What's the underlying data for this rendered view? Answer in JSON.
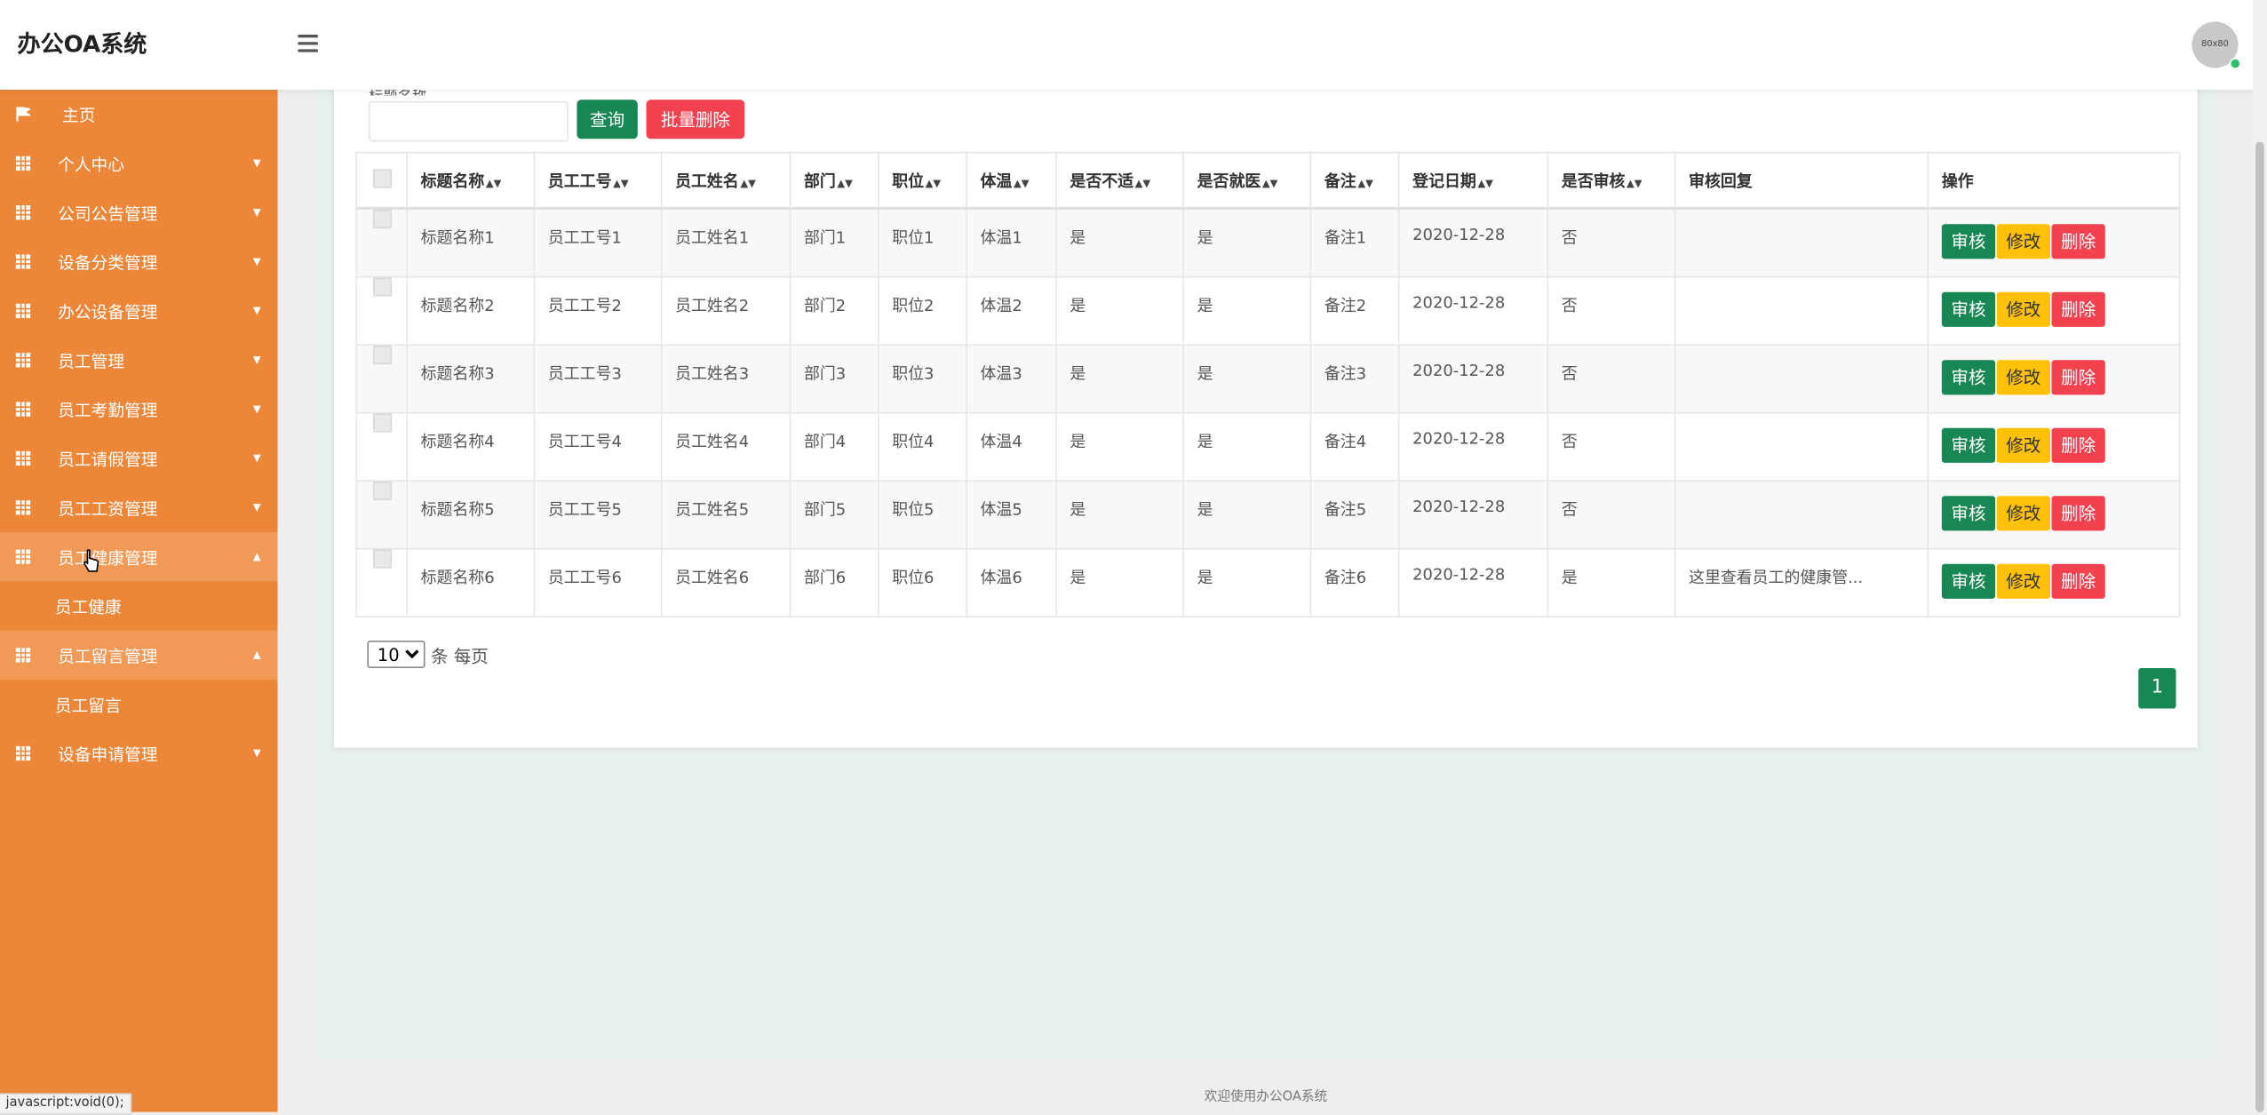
{
  "app": {
    "title": "办公OA系统"
  },
  "header": {
    "avatar_text": "80x80"
  },
  "sidebar": {
    "items": [
      {
        "label": "主页",
        "icon": "flag-icon"
      },
      {
        "label": "个人中心",
        "icon": "grid-icon"
      },
      {
        "label": "公司公告管理",
        "icon": "grid-icon"
      },
      {
        "label": "设备分类管理",
        "icon": "grid-icon"
      },
      {
        "label": "办公设备管理",
        "icon": "grid-icon"
      },
      {
        "label": "员工管理",
        "icon": "grid-icon"
      },
      {
        "label": "员工考勤管理",
        "icon": "grid-icon"
      },
      {
        "label": "员工请假管理",
        "icon": "grid-icon"
      },
      {
        "label": "员工工资管理",
        "icon": "grid-icon"
      },
      {
        "label": "员工健康管理",
        "icon": "grid-icon",
        "expanded": true,
        "children": [
          "员工健康"
        ]
      },
      {
        "label": "员工留言管理",
        "icon": "grid-icon",
        "expanded": true,
        "children": [
          "员工留言"
        ]
      },
      {
        "label": "设备申请管理",
        "icon": "grid-icon"
      }
    ]
  },
  "search": {
    "label": "标题名称",
    "value": "",
    "query_button": "查询",
    "batch_delete_button": "批量删除"
  },
  "table": {
    "columns": [
      "标题名称",
      "员工工号",
      "员工姓名",
      "部门",
      "职位",
      "体温",
      "是否不适",
      "是否就医",
      "备注",
      "登记日期",
      "是否审核",
      "审核回复",
      "操作"
    ],
    "rows": [
      [
        "标题名称1",
        "员工工号1",
        "员工姓名1",
        "部门1",
        "职位1",
        "体温1",
        "是",
        "是",
        "备注1",
        "2020-12-28",
        "否",
        ""
      ],
      [
        "标题名称2",
        "员工工号2",
        "员工姓名2",
        "部门2",
        "职位2",
        "体温2",
        "是",
        "是",
        "备注2",
        "2020-12-28",
        "否",
        ""
      ],
      [
        "标题名称3",
        "员工工号3",
        "员工姓名3",
        "部门3",
        "职位3",
        "体温3",
        "是",
        "是",
        "备注3",
        "2020-12-28",
        "否",
        ""
      ],
      [
        "标题名称4",
        "员工工号4",
        "员工姓名4",
        "部门4",
        "职位4",
        "体温4",
        "是",
        "是",
        "备注4",
        "2020-12-28",
        "否",
        ""
      ],
      [
        "标题名称5",
        "员工工号5",
        "员工姓名5",
        "部门5",
        "职位5",
        "体温5",
        "是",
        "是",
        "备注5",
        "2020-12-28",
        "否",
        ""
      ],
      [
        "标题名称6",
        "员工工号6",
        "员工姓名6",
        "部门6",
        "职位6",
        "体温6",
        "是",
        "是",
        "备注6",
        "2020-12-28",
        "是",
        "这里查看员工的健康管..."
      ]
    ],
    "actions": {
      "audit": "审核",
      "edit": "修改",
      "delete": "删除"
    }
  },
  "pagination": {
    "page_size": "10",
    "page_size_options": [
      "10"
    ],
    "page_size_suffix": "条 每页",
    "current_page": "1"
  },
  "footer": {
    "text": "欢迎使用办公OA系统"
  },
  "status_bar": {
    "url": "javascript:void(0);"
  },
  "colors": {
    "sidebar": "#ec873a",
    "primary": "#198754",
    "danger": "#f2414f",
    "warning": "#ffc107",
    "content_bg": "#e8f1ec"
  }
}
